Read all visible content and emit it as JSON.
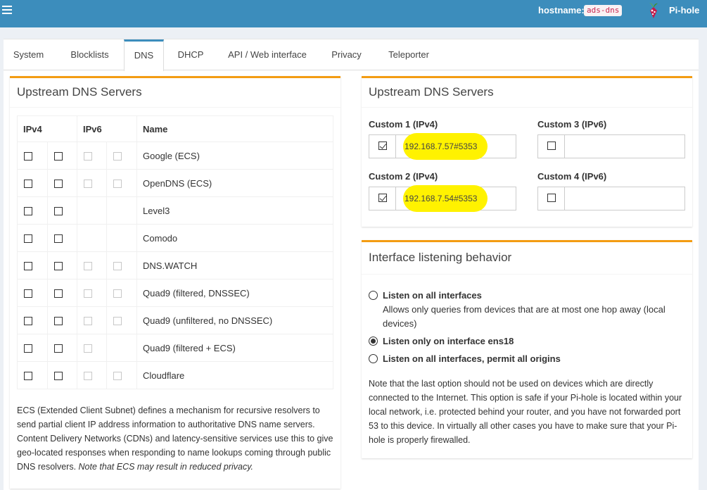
{
  "header": {
    "hostname_label": "hostname:",
    "hostname_value": "ads-dns",
    "brand": "Pi-hole"
  },
  "tabs": [
    {
      "label": "System"
    },
    {
      "label": "Blocklists"
    },
    {
      "label": "DNS",
      "active": true
    },
    {
      "label": "DHCP"
    },
    {
      "label": "API / Web interface"
    },
    {
      "label": "Privacy"
    },
    {
      "label": "Teleporter"
    }
  ],
  "upstream_left": {
    "title": "Upstream DNS Servers",
    "headers": {
      "ipv4": "IPv4",
      "ipv6": "IPv6",
      "name": "Name"
    },
    "rows": [
      {
        "name": "Google (ECS)",
        "ipv6": true
      },
      {
        "name": "OpenDNS (ECS)",
        "ipv6": true
      },
      {
        "name": "Level3",
        "ipv6": false
      },
      {
        "name": "Comodo",
        "ipv6": false
      },
      {
        "name": "DNS.WATCH",
        "ipv6": true
      },
      {
        "name": "Quad9 (filtered, DNSSEC)",
        "ipv6": true
      },
      {
        "name": "Quad9 (unfiltered, no DNSSEC)",
        "ipv6": true
      },
      {
        "name": "Quad9 (filtered + ECS)",
        "ipv6": "one"
      },
      {
        "name": "Cloudflare",
        "ipv6": true
      }
    ],
    "ecs_note": "ECS (Extended Client Subnet) defines a mechanism for recursive resolvers to send partial client IP address information to authoritative DNS name servers. Content Delivery Networks (CDNs) and latency-sensitive services use this to give geo-located responses when responding to name lookups coming through public DNS resolvers.",
    "ecs_note_italic": "Note that ECS may result in reduced privacy."
  },
  "upstream_custom": {
    "title": "Upstream DNS Servers",
    "custom1_label": "Custom 1 (IPv4)",
    "custom1_value": "192.168.7.57#5353",
    "custom1_checked": true,
    "custom2_label": "Custom 2 (IPv4)",
    "custom2_value": "192.168.7.54#5353",
    "custom2_checked": true,
    "custom3_label": "Custom 3 (IPv6)",
    "custom3_value": "",
    "custom4_label": "Custom 4 (IPv6)",
    "custom4_value": "",
    "highlight_color": "#fff200"
  },
  "interface": {
    "title": "Interface listening behavior",
    "option1_label": "Listen on all interfaces",
    "option1_desc": "Allows only queries from devices that are at most one hop away (local devices)",
    "option2_label": "Listen only on interface ens18",
    "option3_label": "Listen on all interfaces, permit all origins",
    "selected": "option2",
    "note": "Note that the last option should not be used on devices which are directly connected to the Internet. This option is safe if your Pi-hole is located within your local network, i.e. protected behind your router, and you have not forwarded port 53 to this device. In virtually all other cases you have to make sure that your Pi-hole is properly firewalled."
  },
  "colors": {
    "header": "#3c8dbc",
    "box_accent": "#f39c12",
    "background": "#ecf0f5"
  }
}
